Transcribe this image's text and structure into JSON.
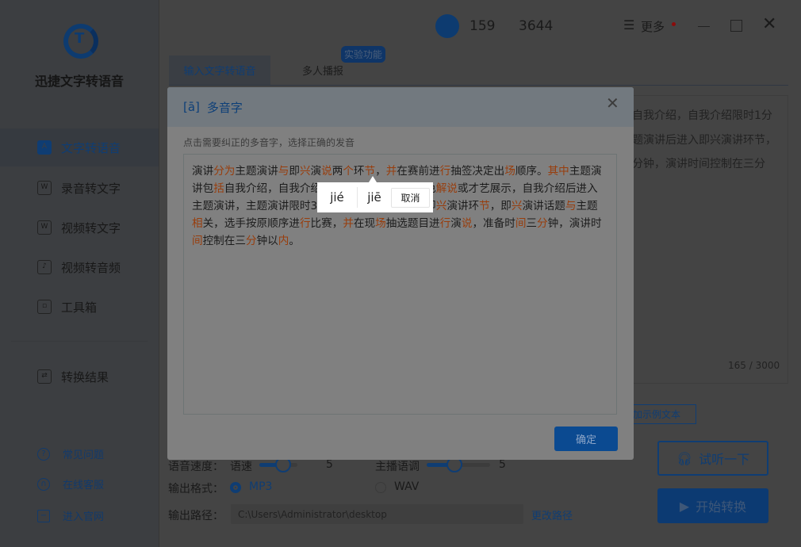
{
  "sidebar": {
    "app_title": "迅捷文字转语音",
    "items": [
      {
        "label": "文字转语音",
        "icon": "text-to-speech-icon"
      },
      {
        "label": "录音转文字",
        "icon": "audio-to-text-icon"
      },
      {
        "label": "视频转文字",
        "icon": "video-to-text-icon"
      },
      {
        "label": "视频转音频",
        "icon": "video-to-audio-icon"
      },
      {
        "label": "工具箱",
        "icon": "toolbox-icon"
      },
      {
        "label": "转换结果",
        "icon": "clipboard-icon"
      }
    ],
    "links": [
      {
        "label": "常见问题",
        "icon": "question-icon"
      },
      {
        "label": "在线客服",
        "icon": "headset-icon"
      },
      {
        "label": "进入官网",
        "icon": "monitor-icon"
      }
    ]
  },
  "titlebar": {
    "phone_start": "159",
    "phone_end": "3644",
    "more": "更多"
  },
  "tabs": [
    {
      "label": "输入文字转语音"
    },
    {
      "label": "多人播报"
    }
  ],
  "badge": "实验功能",
  "background_text": [
    "自我介绍，自我介绍限时1分",
    "题演讲后进入即兴演讲环节，",
    "分钟，演讲时间控制在三分"
  ],
  "counter": "165 / 3000",
  "add_sample": "添加示例文本",
  "dialog": {
    "title_icon": "[ā]",
    "title": "多音字",
    "hint": "点击需要纠正的多音字，选择正确的发音",
    "confirm": "确定",
    "segments": [
      [
        "演讲",
        0
      ],
      [
        "分为",
        1
      ],
      [
        "主题演讲",
        0
      ],
      [
        "与",
        1
      ],
      [
        "即",
        0
      ],
      [
        "兴",
        1
      ],
      [
        "演",
        0
      ],
      [
        "说",
        1
      ],
      [
        "两",
        0
      ],
      [
        "个",
        1
      ],
      [
        "环",
        0
      ],
      [
        "节",
        1
      ],
      [
        "，",
        0
      ],
      [
        "并",
        1
      ],
      [
        "在赛前进",
        0
      ],
      [
        "行",
        1
      ],
      [
        "抽签决定出",
        0
      ],
      [
        "场",
        1
      ],
      [
        "顺序。",
        0
      ],
      [
        "其中",
        1
      ],
      [
        "主题演讲包",
        0
      ],
      [
        "括",
        1
      ],
      [
        "自我介绍，自我介绍限时1分钟，可进行特色",
        0
      ],
      [
        "解说",
        1
      ],
      [
        "或才艺展示，自我介绍后进入主题演讲，主题演讲限时3分钟，主题演讲后进入即",
        0
      ],
      [
        "兴",
        1
      ],
      [
        "演讲环",
        0
      ],
      [
        "节",
        1
      ],
      [
        "，即",
        0
      ],
      [
        "兴",
        1
      ],
      [
        "演讲话题",
        0
      ],
      [
        "与",
        1
      ],
      [
        "主题",
        0
      ],
      [
        "相",
        1
      ],
      [
        "关，选手按原顺序进",
        0
      ],
      [
        "行",
        1
      ],
      [
        "比赛，",
        0
      ],
      [
        "并",
        1
      ],
      [
        "在现",
        0
      ],
      [
        "场",
        1
      ],
      [
        "抽选题目进",
        0
      ],
      [
        "行",
        1
      ],
      [
        "演",
        0
      ],
      [
        "说",
        1
      ],
      [
        "，准备时",
        0
      ],
      [
        "间",
        1
      ],
      [
        "三",
        0
      ],
      [
        "分",
        1
      ],
      [
        "钟，演讲时",
        0
      ],
      [
        "间",
        1
      ],
      [
        "控制在三",
        0
      ],
      [
        "分",
        1
      ],
      [
        "钟以",
        0
      ],
      [
        "内",
        1
      ],
      [
        "。",
        0
      ]
    ]
  },
  "popup": {
    "options": [
      "jié",
      "jiē"
    ],
    "cancel": "取消"
  },
  "settings": {
    "speed_label": "语音速度：",
    "speed_name": "语速",
    "speed_value": "5",
    "pitch_label": "主播语调",
    "pitch_value": "5",
    "format_label": "输出格式：",
    "formats": [
      "MP3",
      "WAV"
    ],
    "selected_format": "MP3",
    "path_label": "输出路径：",
    "path_value": "C:\\Users\\Administrator\\desktop",
    "change_path": "更改路径"
  },
  "actions": {
    "preview": "试听一下",
    "start": "开始转换"
  },
  "colors": {
    "accent": "#0f3d73",
    "highlight": "#983d0c"
  }
}
